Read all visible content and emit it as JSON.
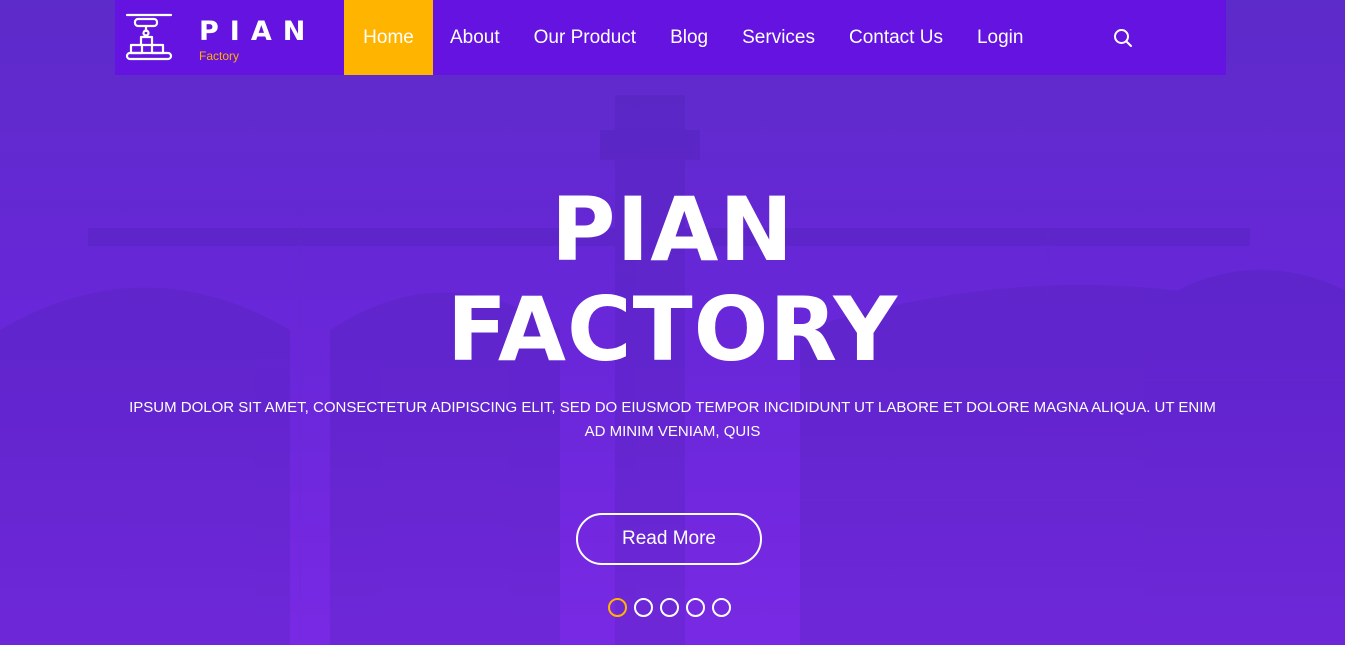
{
  "brand": {
    "name": "PIAN",
    "subtitle": "Factory",
    "logo_icon": "conveyor-robot-icon"
  },
  "nav": {
    "items": [
      {
        "label": "Home",
        "active": true
      },
      {
        "label": "About",
        "active": false
      },
      {
        "label": "Our Product",
        "active": false
      },
      {
        "label": "Blog",
        "active": false
      },
      {
        "label": "Services",
        "active": false
      },
      {
        "label": "Contact Us",
        "active": false
      },
      {
        "label": "Login",
        "active": false
      }
    ],
    "search_icon": "search-icon"
  },
  "hero": {
    "title_line1": "PIAN",
    "title_line2": "FACTORY",
    "description": "IPSUM DOLOR SIT AMET, CONSECTETUR ADIPISCING ELIT, SED DO EIUSMOD TEMPOR INCIDIDUNT UT LABORE ET DOLORE MAGNA ALIQUA. UT ENIM AD MINIM VENIAM, QUIS",
    "button_label": "Read More",
    "slides_total": 5,
    "active_slide": 1
  },
  "colors": {
    "nav_bg": "#6513e0",
    "accent": "#ffb400",
    "hero_overlay": "#6a2ad6",
    "text": "#ffffff"
  }
}
